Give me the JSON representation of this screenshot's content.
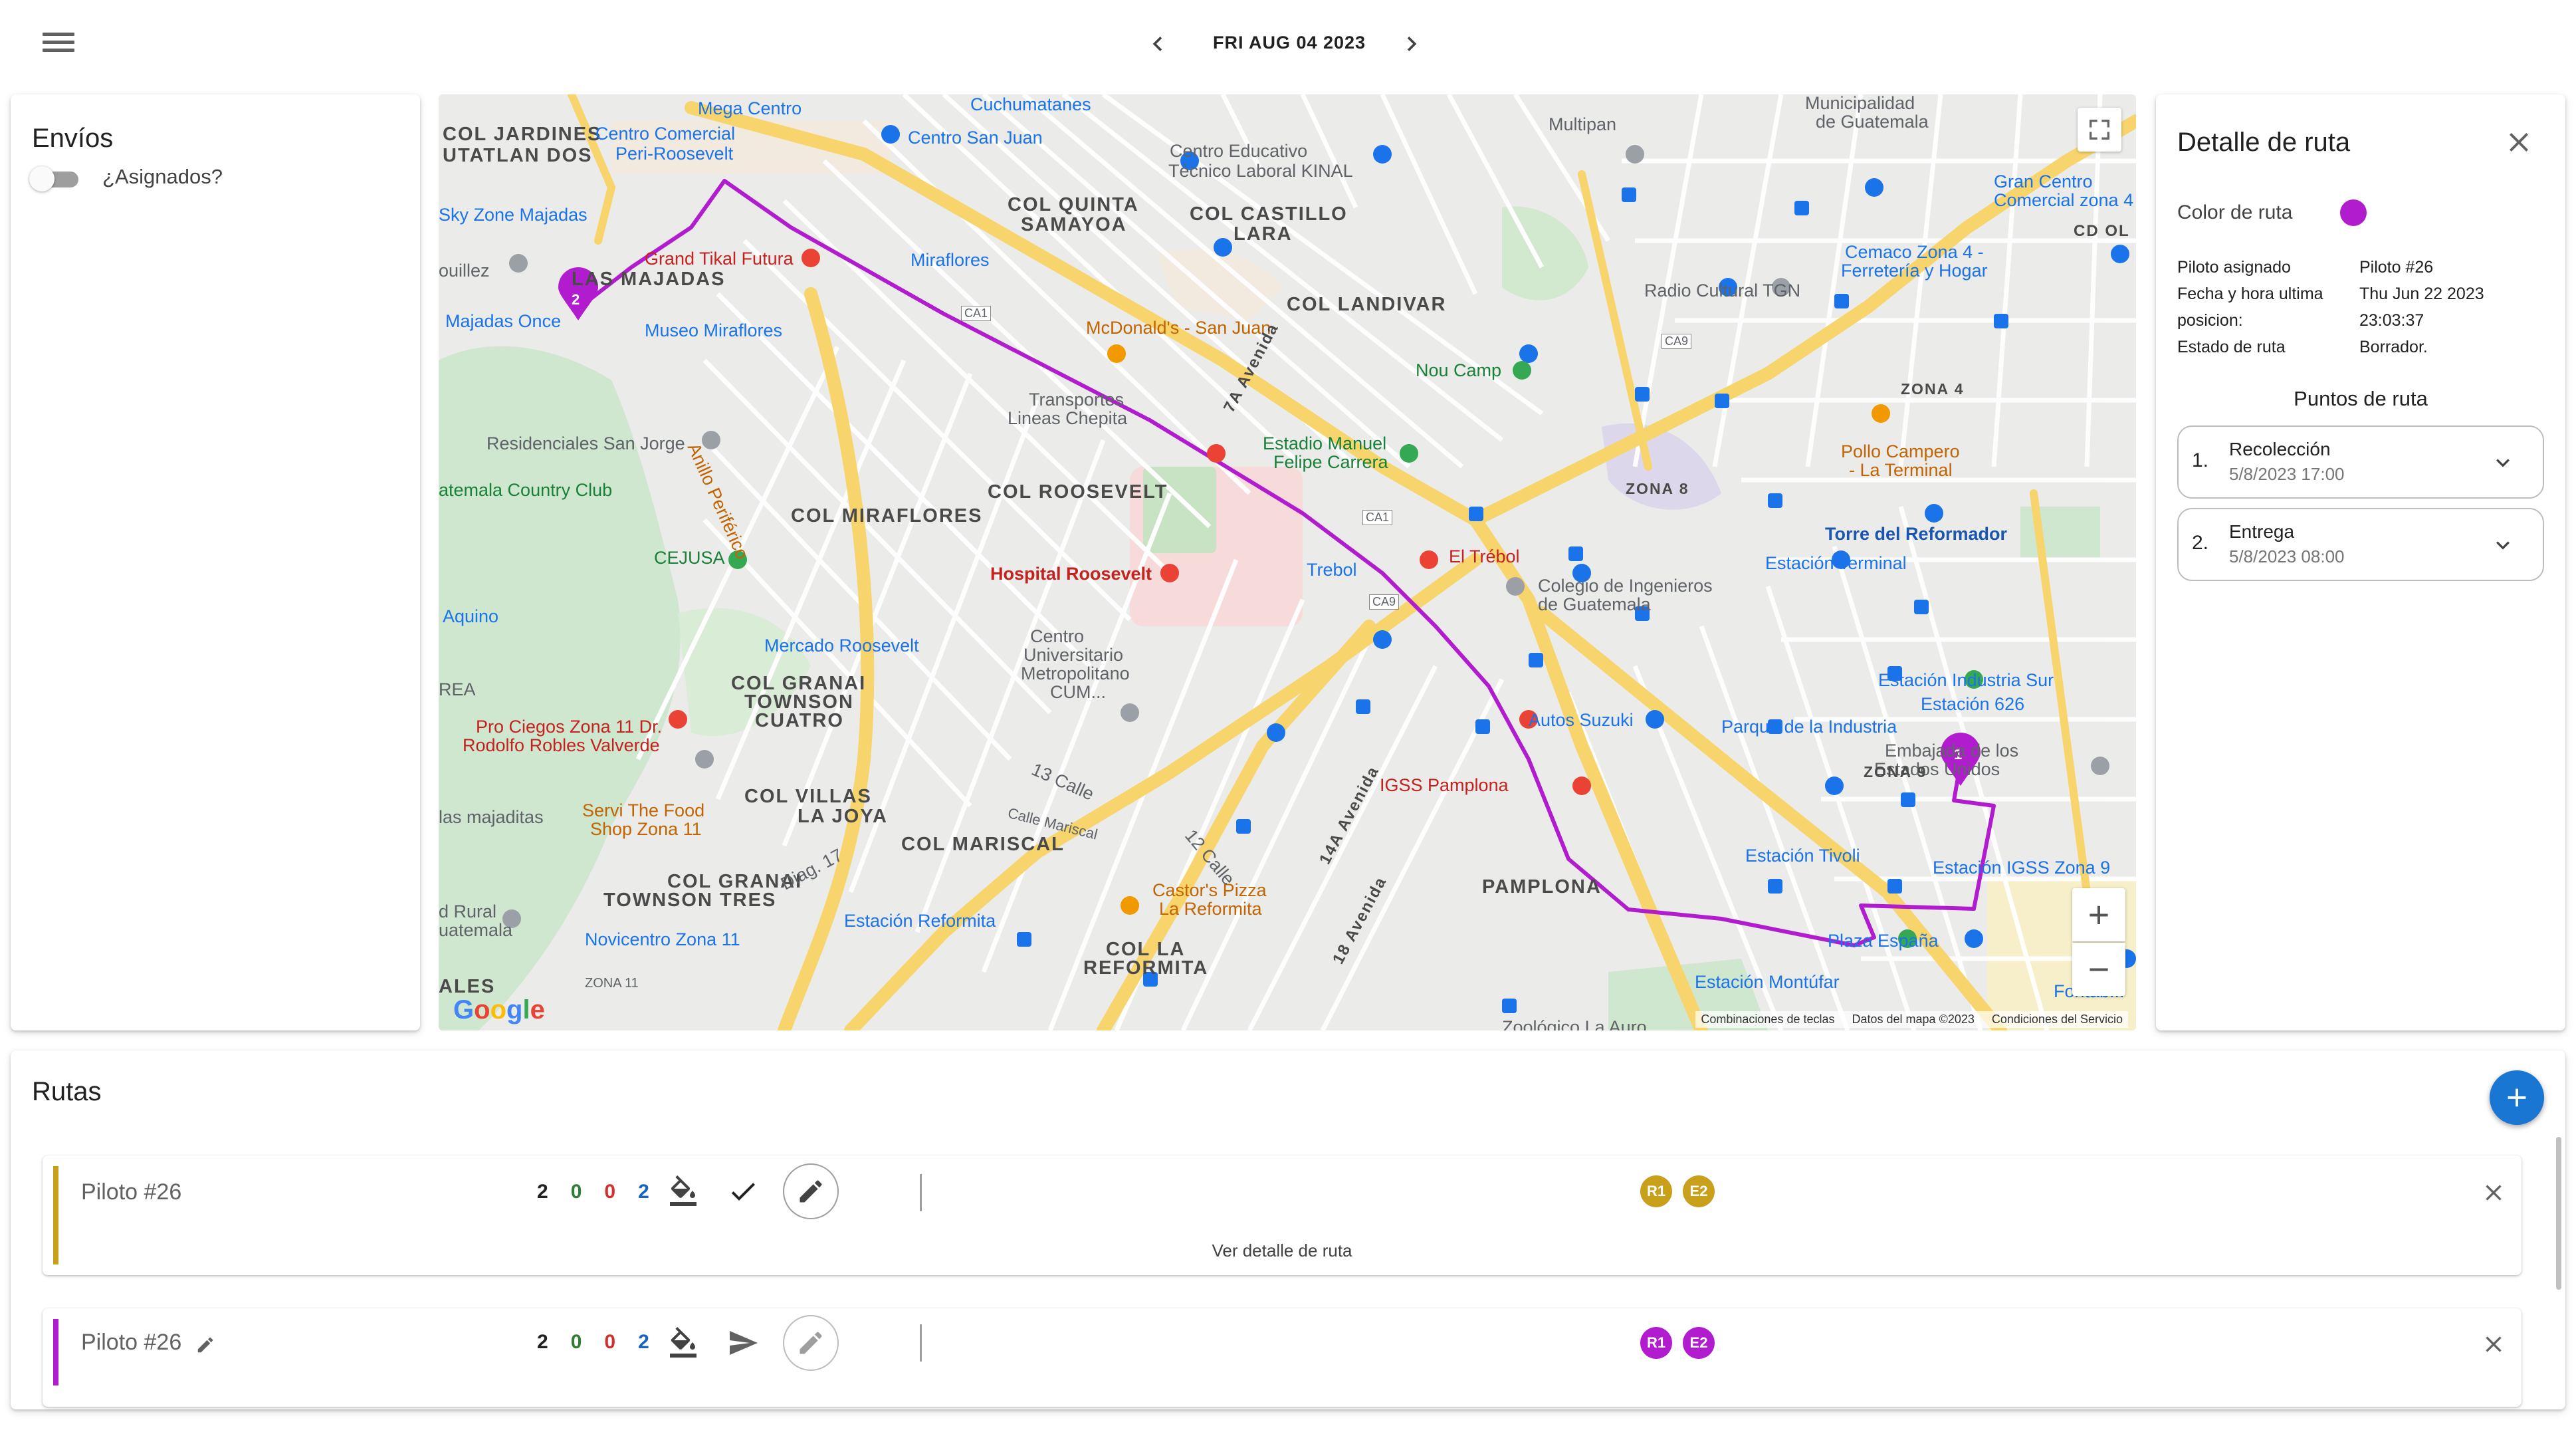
{
  "header": {
    "menu_icon": "menu-icon",
    "date": "FRI AUG 04 2023",
    "prev_icon": "chevron-left-icon",
    "next_icon": "chevron-right-icon"
  },
  "envios": {
    "title": "Envíos",
    "toggle_label": "¿Asignados?",
    "toggle_on": false
  },
  "map": {
    "labels": {
      "col_jardines": "COL JARDINES",
      "utatlan_dos": "UTATLAN DOS",
      "mega_centro": "Mega Centro",
      "centro_comercial": "Centro Comercial",
      "peri_roosevelt": "Peri-Roosevelt",
      "sky_zone": "Sky Zone Majadas",
      "grand_tikal": "Grand Tikal Futura",
      "las_majadas": "LAS MAJADAS",
      "majadas_once": "Majadas Once",
      "museo_miraflores": "Museo Miraflores",
      "miraflores": "Miraflores",
      "residenciales": "Residenciales San Jorge",
      "country_club": "atemala Country Club",
      "cejusa": "CEJUSA",
      "aquino": "Aquino",
      "anillo_periferico": "Anillo Periférico",
      "cuchumatanes": "Cuchumatanes",
      "centro_san_juan": "Centro San Juan",
      "col_quinta": "COL QUINTA",
      "samayoa": "SAMAYOA",
      "centro_educativo": "Centro Educativo",
      "tecnico_laboral": "Técnico Laboral KINAL",
      "col_castillo": "COL CASTILLO",
      "lara": "LARA",
      "mcdonalds": "McDonald's - San Juan",
      "transportes": "Transportes",
      "lineas_chepita": "Lineas Chepita",
      "col_landivar": "COL LANDIVAR",
      "col_roosevelt": "COL ROOSEVELT",
      "col_miraflores": "COL MIRAFLORES",
      "hospital_roosevelt": "Hospital Roosevelt",
      "mercado_roosevelt": "Mercado Roosevelt",
      "centro_uni_1": "Centro",
      "centro_uni_2": "Universitario",
      "centro_uni_3": "Metropolitano",
      "centro_uni_4": "CUM...",
      "col_granai": "COL GRANAI",
      "townson_cuatro": "TOWNSON",
      "cuatro": "CUATRO",
      "pro_ciegos": "Pro Ciegos Zona 11 Dr.",
      "rodolfo": "Rodolfo Robles Valverde",
      "col_villas": "COL VILLAS",
      "la_joya": "LA JOYA",
      "col_mariscal": "COL MARISCAL",
      "las_majaditas": "las majaditas",
      "servi_food": "Servi The Food",
      "shop_zona": "Shop Zona 11",
      "col_granai_tres": "COL GRANAI",
      "townson_tres": "TOWNSON TRES",
      "estacion_reformita": "Estación Reformita",
      "novicentro": "Novicentro Zona 11",
      "col_la": "COL LA",
      "reformita": "REFORMITA",
      "castors_pizza": "Castor's Pizza",
      "la_reformita": "La Reformita",
      "estadio_manuel": "Estadio Manuel",
      "felipe_carrera": "Felipe Carrera",
      "el_trebol": "El Trébol",
      "trebol": "Trebol",
      "nou_camp": "Nou Camp",
      "multipan": "Multipan",
      "municipalidad": "Municipalidad",
      "de_guatemala": "de Guatemala",
      "gran_centro": "Gran Centro",
      "comercial_zona": "Comercial zona 4",
      "radio_cultural": "Radio Cultural TGN",
      "cemaco": "Cemaco Zona 4 -",
      "ferreteria": "Ferretería y Hogar",
      "pollo_campero": "Pollo Campero",
      "la_terminal": "- La Terminal",
      "zona_4": "ZONA 4",
      "zona_8": "ZONA 8",
      "torre_reformador": "Torre del Reformador",
      "estacion_terminal": "Estación Terminal",
      "colegio_ingenieros": "Colegio de Ingenieros",
      "de_guatemala_2": "de Guatemala",
      "estacion_industria": "Estación Industria Sur",
      "estacion_626": "Estación 626",
      "parque_industria": "Parque de la Industria",
      "autos_suzuki": "Autos Suzuki",
      "igss_pamplona": "IGSS Pamplona",
      "embajada": "Embajada de los",
      "estados_unidos": "Estados Unidos",
      "zona_9": "ZONA 9",
      "estacion_tivoli": "Estación Tivoli",
      "estacion_igss": "Estación IGSS Zona 9",
      "pamplona": "PAMPLONA",
      "plaza_espana": "Plaza España",
      "estacion_montufar": "Estación Montúfar",
      "fontabella": "Fontab...",
      "zoologico": "Zoológico La Auro",
      "trece_calle": "13 Calle",
      "doce_calle": "12 Calle",
      "calle_mariscal": "Calle Mariscal",
      "ave_7a": "7A Avenida",
      "ave_14a": "14A Avenida",
      "ave_18": "18 Avenida",
      "ca1": "CA1",
      "ca9": "CA9",
      "cd_ol": "CD OL",
      "zona_11": "ZONA 11",
      "rural": "d Rural",
      "atemala": "uatemala",
      "ales": "ALES",
      "rea": "REA",
      "ouillez": "ouillez",
      "diag17": "Diag. 17"
    },
    "footer": [
      "Combinaciones de teclas",
      "Datos del mapa ©2023",
      "Condiciones del Servicio"
    ],
    "google": "Google",
    "fullscreen_icon": "fullscreen-icon",
    "zoom_in": "+",
    "zoom_out": "−",
    "marker_1": "1",
    "marker_2": "2",
    "route_color": "#b21ccf"
  },
  "detail": {
    "title": "Detalle de ruta",
    "close_icon": "close-icon",
    "color_label": "Color de ruta",
    "color": "#b21ccf",
    "piloto_label": "Piloto asignado",
    "piloto_value": "Piloto #26",
    "fecha_label_1": "Fecha y hora ultima",
    "fecha_label_2": "posicion:",
    "fecha_value_1": "Thu Jun 22 2023",
    "fecha_value_2": "23:03:37",
    "estado_label": "Estado de ruta",
    "estado_value": "Borrador.",
    "puntos_title": "Puntos de ruta",
    "puntos": [
      {
        "num": "1.",
        "type": "Recolección",
        "date": "5/8/2023 17:00"
      },
      {
        "num": "2.",
        "type": "Entrega",
        "date": "5/8/2023 08:00"
      }
    ]
  },
  "rutas": {
    "title": "Rutas",
    "add_icon": "add-icon",
    "ver_detalle": "Ver detalle de ruta",
    "routes": [
      {
        "pilot": "Piloto #26",
        "color": "#c9a01a",
        "counts": [
          "2",
          "0",
          "0",
          "2"
        ],
        "count_colors": [
          "#212121",
          "#2e7d32",
          "#d32f2f",
          "#1565c0"
        ],
        "status_icon": "check-icon",
        "badges": [
          "R1",
          "E2"
        ]
      },
      {
        "pilot": "Piloto #26",
        "color": "#b21ccf",
        "counts": [
          "2",
          "0",
          "0",
          "2"
        ],
        "count_colors": [
          "#212121",
          "#2e7d32",
          "#d32f2f",
          "#1565c0"
        ],
        "status_icon": "send-icon",
        "badges": [
          "R1",
          "E2"
        ]
      }
    ]
  }
}
